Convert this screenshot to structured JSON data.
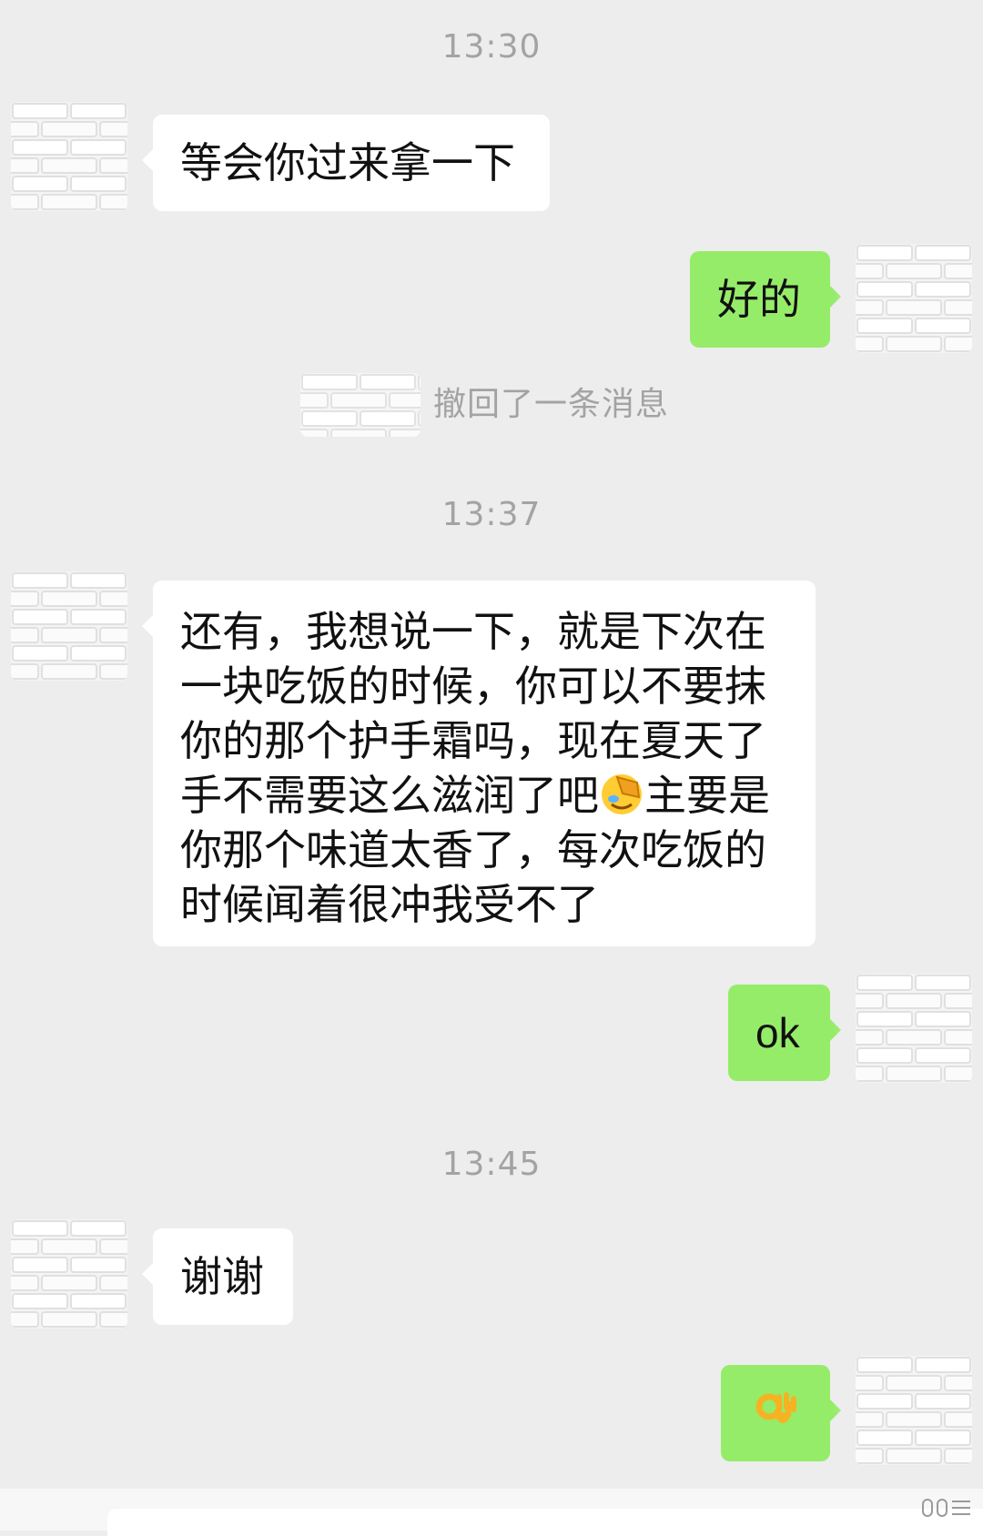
{
  "timestamps": [
    "13:30",
    "13:37",
    "13:45"
  ],
  "messages": {
    "m1": "等会你过来拿一下",
    "m2": "好的",
    "m3_lines": [
      "还有，我想说一下，就是下次在",
      "一块吃饭的时候，你可以不要抹",
      "你的那个护手霜吗，现在夏天了",
      "手不需要这么滋润了吧",
      "主要是",
      "你那个味道太香了，每次吃饭的",
      "时候闻着很冲我受不了"
    ],
    "m4": "ok",
    "m5": "谢谢",
    "m6": "👌"
  },
  "recall": {
    "text": "撤回了一条消息"
  },
  "icons": {
    "emoji_in_m3": "facepalm-emoji",
    "emoji_m6": "ok-hand-emoji",
    "avatar": "brick-wall-avatar"
  },
  "colors": {
    "background": "#ededed",
    "bubble_in": "#ffffff",
    "bubble_out": "#95ec69",
    "timestamp_text": "#a3a3a3"
  }
}
